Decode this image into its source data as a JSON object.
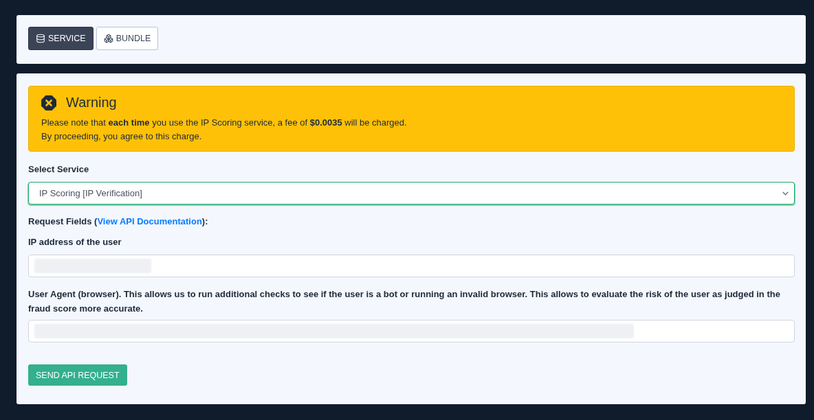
{
  "tabs": [
    {
      "label": "SERVICE",
      "selected": true
    },
    {
      "label": "BUNDLE",
      "selected": false
    }
  ],
  "warning": {
    "title": "Warning",
    "lines": [
      "Please note that **each time** you use the IP Scoring service, a fee of **$0.0035** will be charged.",
      "By proceeding, you agree to this charge."
    ]
  },
  "service_select": {
    "label": "Select Service",
    "value": "IP Scoring [IP Verification]",
    "focused": true
  },
  "request_fields": {
    "label_start": "Request Fields (",
    "link": "View API Documentation",
    "label_end": "):"
  },
  "fields": [
    {
      "label": "IP address of the user",
      "redacted": true
    },
    {
      "label": "User Agent (browser). This allows us to run additional checks to see if the user is a bot or running an invalid browser. This allows to evaluate the risk of the user as judged in the fraud score more accurate.",
      "redacted": true
    }
  ],
  "submit_button": {
    "label": "SEND API REQUEST"
  }
}
